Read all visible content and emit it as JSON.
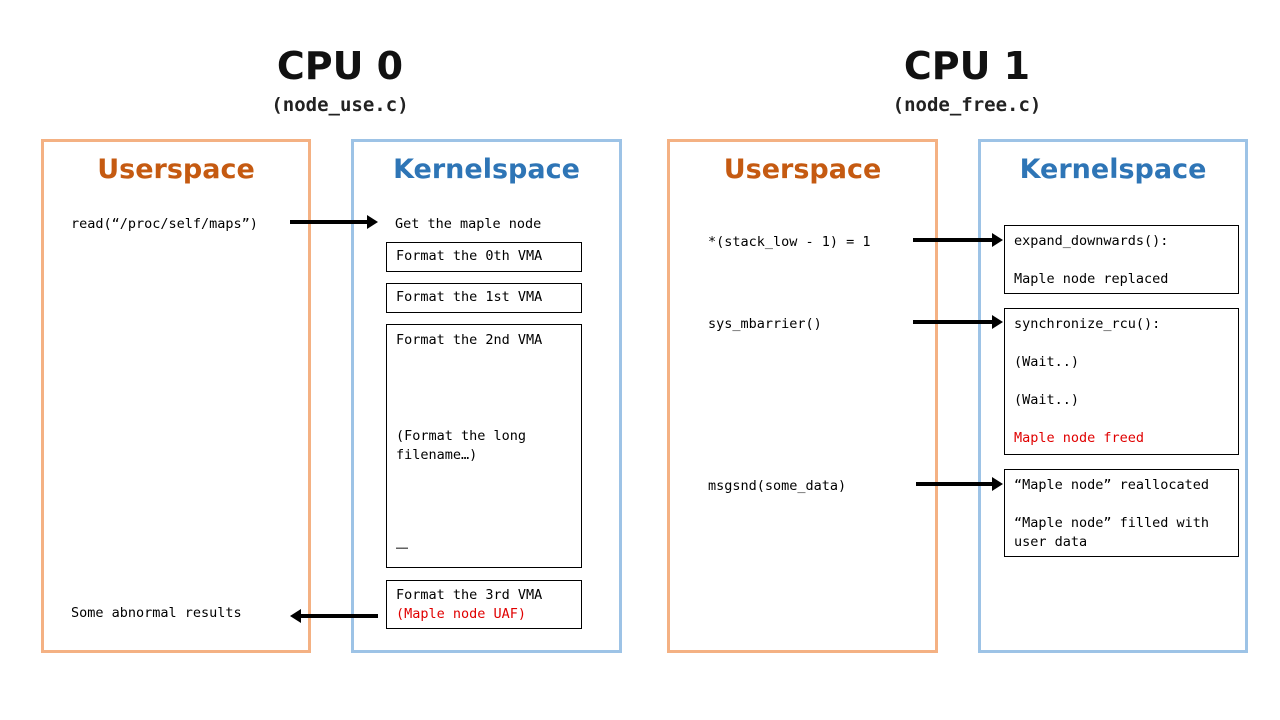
{
  "cpu0": {
    "title": "CPU 0",
    "file": "(node_use.c)",
    "userspace": {
      "title": "Userspace",
      "call": "read(“/proc/self/maps”)",
      "result": "Some abnormal results"
    },
    "kernelspace": {
      "title": "Kernelspace",
      "get_node": "Get the maple node",
      "vma0": "Format the 0th VMA",
      "vma1": "Format the 1st VMA",
      "vma2": "Format the 2nd VMA",
      "vma2_long": "(Format the long",
      "vma2_long2": "filename…)",
      "vma2_dots": "……",
      "vma3": "Format the 3rd VMA",
      "vma3_uaf": "(Maple node UAF)"
    }
  },
  "cpu1": {
    "title": "CPU 1",
    "file": "(node_free.c)",
    "userspace": {
      "title": "Userspace",
      "stack": "*(stack_low - 1) = 1",
      "mbarrier": "sys_mbarrier()",
      "msgsnd": "msgsnd(some_data)"
    },
    "kernelspace": {
      "title": "Kernelspace",
      "expand": "expand_downwards():",
      "replaced": "Maple node replaced",
      "sync": "synchronize_rcu():",
      "wait1": "(Wait..)",
      "wait2": "(Wait..)",
      "freed": "Maple node freed",
      "realloc": "“Maple node” reallocated",
      "filled": "“Maple node” filled with",
      "filled2": "user data"
    }
  },
  "colors": {
    "userspace_border": "#f4b183",
    "kernelspace_border": "#9dc3e6",
    "userspace_title": "#c55a11",
    "kernelspace_title": "#2e75b6",
    "highlight": "#e00000"
  }
}
